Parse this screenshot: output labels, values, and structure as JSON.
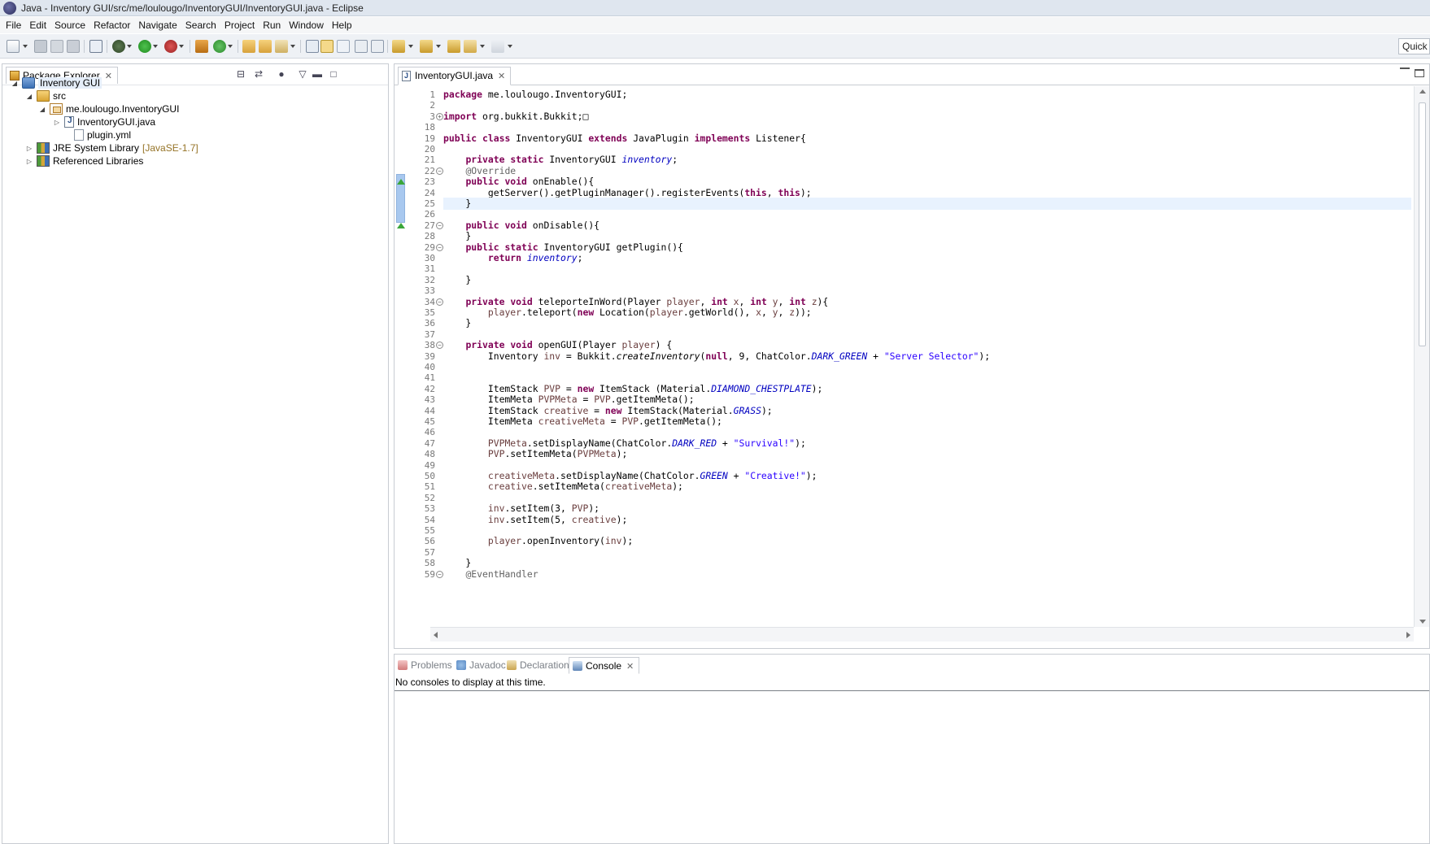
{
  "window": {
    "title": "Java - Inventory GUI/src/me/loulougo/InventoryGUI/InventoryGUI.java - Eclipse"
  },
  "menubar": [
    "File",
    "Edit",
    "Source",
    "Refactor",
    "Navigate",
    "Search",
    "Project",
    "Run",
    "Window",
    "Help"
  ],
  "toolbar": {
    "quick_access_label": "Quick"
  },
  "package_explorer": {
    "tab_label": "Package Explorer",
    "tree": [
      {
        "label": "Inventory GUI",
        "icon": "project-icon",
        "expanded": true,
        "selected": true
      },
      {
        "label": "src",
        "icon": "source-folder-icon",
        "expanded": true
      },
      {
        "label": "me.loulougo.InventoryGUI",
        "icon": "package-icon",
        "expanded": true
      },
      {
        "label": "InventoryGUI.java",
        "icon": "java-file-icon",
        "expanded": false
      },
      {
        "label": "plugin.yml",
        "icon": "yml-file-icon"
      },
      {
        "label": "JRE System Library",
        "suffix": "[JavaSE-1.7]",
        "icon": "library-icon",
        "expanded": false
      },
      {
        "label": "Referenced Libraries",
        "icon": "library-icon",
        "expanded": false
      }
    ]
  },
  "editor": {
    "tab_label": "InventoryGUI.java",
    "current_line": 25,
    "lines": [
      {
        "n": "1",
        "html": "<span class=\"kw\">package</span> me.loulougo.InventoryGUI;"
      },
      {
        "n": "2",
        "html": ""
      },
      {
        "n": "3",
        "fold": "plus",
        "html": "<span class=\"kw\">import</span> org.bukkit.Bukkit;&#9633;"
      },
      {
        "n": "18",
        "html": ""
      },
      {
        "n": "19",
        "html": "<span class=\"kw\">public</span> <span class=\"kw\">class</span> InventoryGUI <span class=\"kw\">extends</span> JavaPlugin <span class=\"kw\">implements</span> Listener{"
      },
      {
        "n": "20",
        "html": ""
      },
      {
        "n": "21",
        "html": "    <span class=\"kw\">private</span> <span class=\"kw\">static</span> InventoryGUI <span class=\"fld\">inventory</span>;"
      },
      {
        "n": "22",
        "fold": "minus",
        "html": "    <span class=\"ann\">@Override</span>"
      },
      {
        "n": "23",
        "override": true,
        "html": "    <span class=\"kw\">public</span> <span class=\"kw\">void</span> onEnable(){"
      },
      {
        "n": "24",
        "html": "        getServer().getPluginManager().registerEvents(<span class=\"kw\">this</span>, <span class=\"kw\">this</span>);"
      },
      {
        "n": "25",
        "html": "    }"
      },
      {
        "n": "26",
        "html": ""
      },
      {
        "n": "27",
        "fold": "minus",
        "override": true,
        "html": "    <span class=\"kw\">public</span> <span class=\"kw\">void</span> onDisable(){"
      },
      {
        "n": "28",
        "html": "    }"
      },
      {
        "n": "29",
        "fold": "minus",
        "html": "    <span class=\"kw\">public</span> <span class=\"kw\">static</span> InventoryGUI getPlugin(){"
      },
      {
        "n": "30",
        "html": "        <span class=\"kw\">return</span> <span class=\"fld\">inventory</span>;"
      },
      {
        "n": "31",
        "html": ""
      },
      {
        "n": "32",
        "html": "    }"
      },
      {
        "n": "33",
        "html": ""
      },
      {
        "n": "34",
        "fold": "minus",
        "html": "    <span class=\"kw\">private</span> <span class=\"kw\">void</span> teleporteInWord(Player <span class=\"prm\">player</span>, <span class=\"kw\">int</span> <span class=\"prm\">x</span>, <span class=\"kw\">int</span> <span class=\"prm\">y</span>, <span class=\"kw\">int</span> <span class=\"prm\">z</span>){"
      },
      {
        "n": "35",
        "html": "        <span class=\"prm\">player</span>.teleport(<span class=\"kw\">new</span> Location(<span class=\"prm\">player</span>.getWorld(), <span class=\"prm\">x</span>, <span class=\"prm\">y</span>, <span class=\"prm\">z</span>));"
      },
      {
        "n": "36",
        "html": "    }"
      },
      {
        "n": "37",
        "html": ""
      },
      {
        "n": "38",
        "fold": "minus",
        "html": "    <span class=\"kw\">private</span> <span class=\"kw\">void</span> openGUI(Player <span class=\"prm\">player</span>) {"
      },
      {
        "n": "39",
        "html": "        Inventory <span class=\"prm\">inv</span> = Bukkit.<i>createInventory</i>(<span class=\"kw\">null</span>, 9, ChatColor.<span class=\"fld\">DARK_GREEN</span> + <span class=\"str\">\"Server Selector\"</span>);"
      },
      {
        "n": "40",
        "html": ""
      },
      {
        "n": "41",
        "html": ""
      },
      {
        "n": "42",
        "html": "        ItemStack <span class=\"prm\">PVP</span> = <span class=\"kw\">new</span> ItemStack (Material.<span class=\"fld\">DIAMOND_CHESTPLATE</span>);"
      },
      {
        "n": "43",
        "html": "        ItemMeta <span class=\"prm\">PVPMeta</span> = <span class=\"prm\">PVP</span>.getItemMeta();"
      },
      {
        "n": "44",
        "html": "        ItemStack <span class=\"prm\">creative</span> = <span class=\"kw\">new</span> ItemStack(Material.<span class=\"fld\">GRASS</span>);"
      },
      {
        "n": "45",
        "html": "        ItemMeta <span class=\"prm\">creativeMeta</span> = <span class=\"prm\">PVP</span>.getItemMeta();"
      },
      {
        "n": "46",
        "html": ""
      },
      {
        "n": "47",
        "html": "        <span class=\"prm\">PVPMeta</span>.setDisplayName(ChatColor.<span class=\"fld\">DARK_RED</span> + <span class=\"str\">\"Survival!\"</span>);"
      },
      {
        "n": "48",
        "html": "        <span class=\"prm\">PVP</span>.setItemMeta(<span class=\"prm\">PVPMeta</span>);"
      },
      {
        "n": "49",
        "html": ""
      },
      {
        "n": "50",
        "html": "        <span class=\"prm\">creativeMeta</span>.setDisplayName(ChatColor.<span class=\"fld\">GREEN</span> + <span class=\"str\">\"Creative!\"</span>);"
      },
      {
        "n": "51",
        "html": "        <span class=\"prm\">creative</span>.setItemMeta(<span class=\"prm\">creativeMeta</span>);"
      },
      {
        "n": "52",
        "html": ""
      },
      {
        "n": "53",
        "html": "        <span class=\"prm\">inv</span>.setItem(3, <span class=\"prm\">PVP</span>);"
      },
      {
        "n": "54",
        "html": "        <span class=\"prm\">inv</span>.setItem(5, <span class=\"prm\">creative</span>);"
      },
      {
        "n": "55",
        "html": ""
      },
      {
        "n": "56",
        "html": "        <span class=\"prm\">player</span>.openInventory(<span class=\"prm\">inv</span>);"
      },
      {
        "n": "57",
        "html": ""
      },
      {
        "n": "58",
        "html": "    }"
      },
      {
        "n": "59",
        "fold": "minus",
        "html": "    <span class=\"ann\">@EventHandler</span>"
      }
    ]
  },
  "bottom_panel": {
    "tabs": [
      {
        "label": "Problems",
        "icon": "problems-icon",
        "active": false
      },
      {
        "label": "Javadoc",
        "icon": "javadoc-icon",
        "active": false
      },
      {
        "label": "Declaration",
        "icon": "declaration-icon",
        "active": false
      },
      {
        "label": "Console",
        "icon": "console-icon",
        "active": true
      }
    ],
    "console_message": "No consoles to display at this time."
  },
  "colors": {
    "keyword": "#7f0055",
    "annotation": "#646464",
    "static_field": "#0000c0",
    "string": "#2a00ff",
    "local_variable": "#6a3e3e",
    "current_line": "#e8f2fe"
  }
}
